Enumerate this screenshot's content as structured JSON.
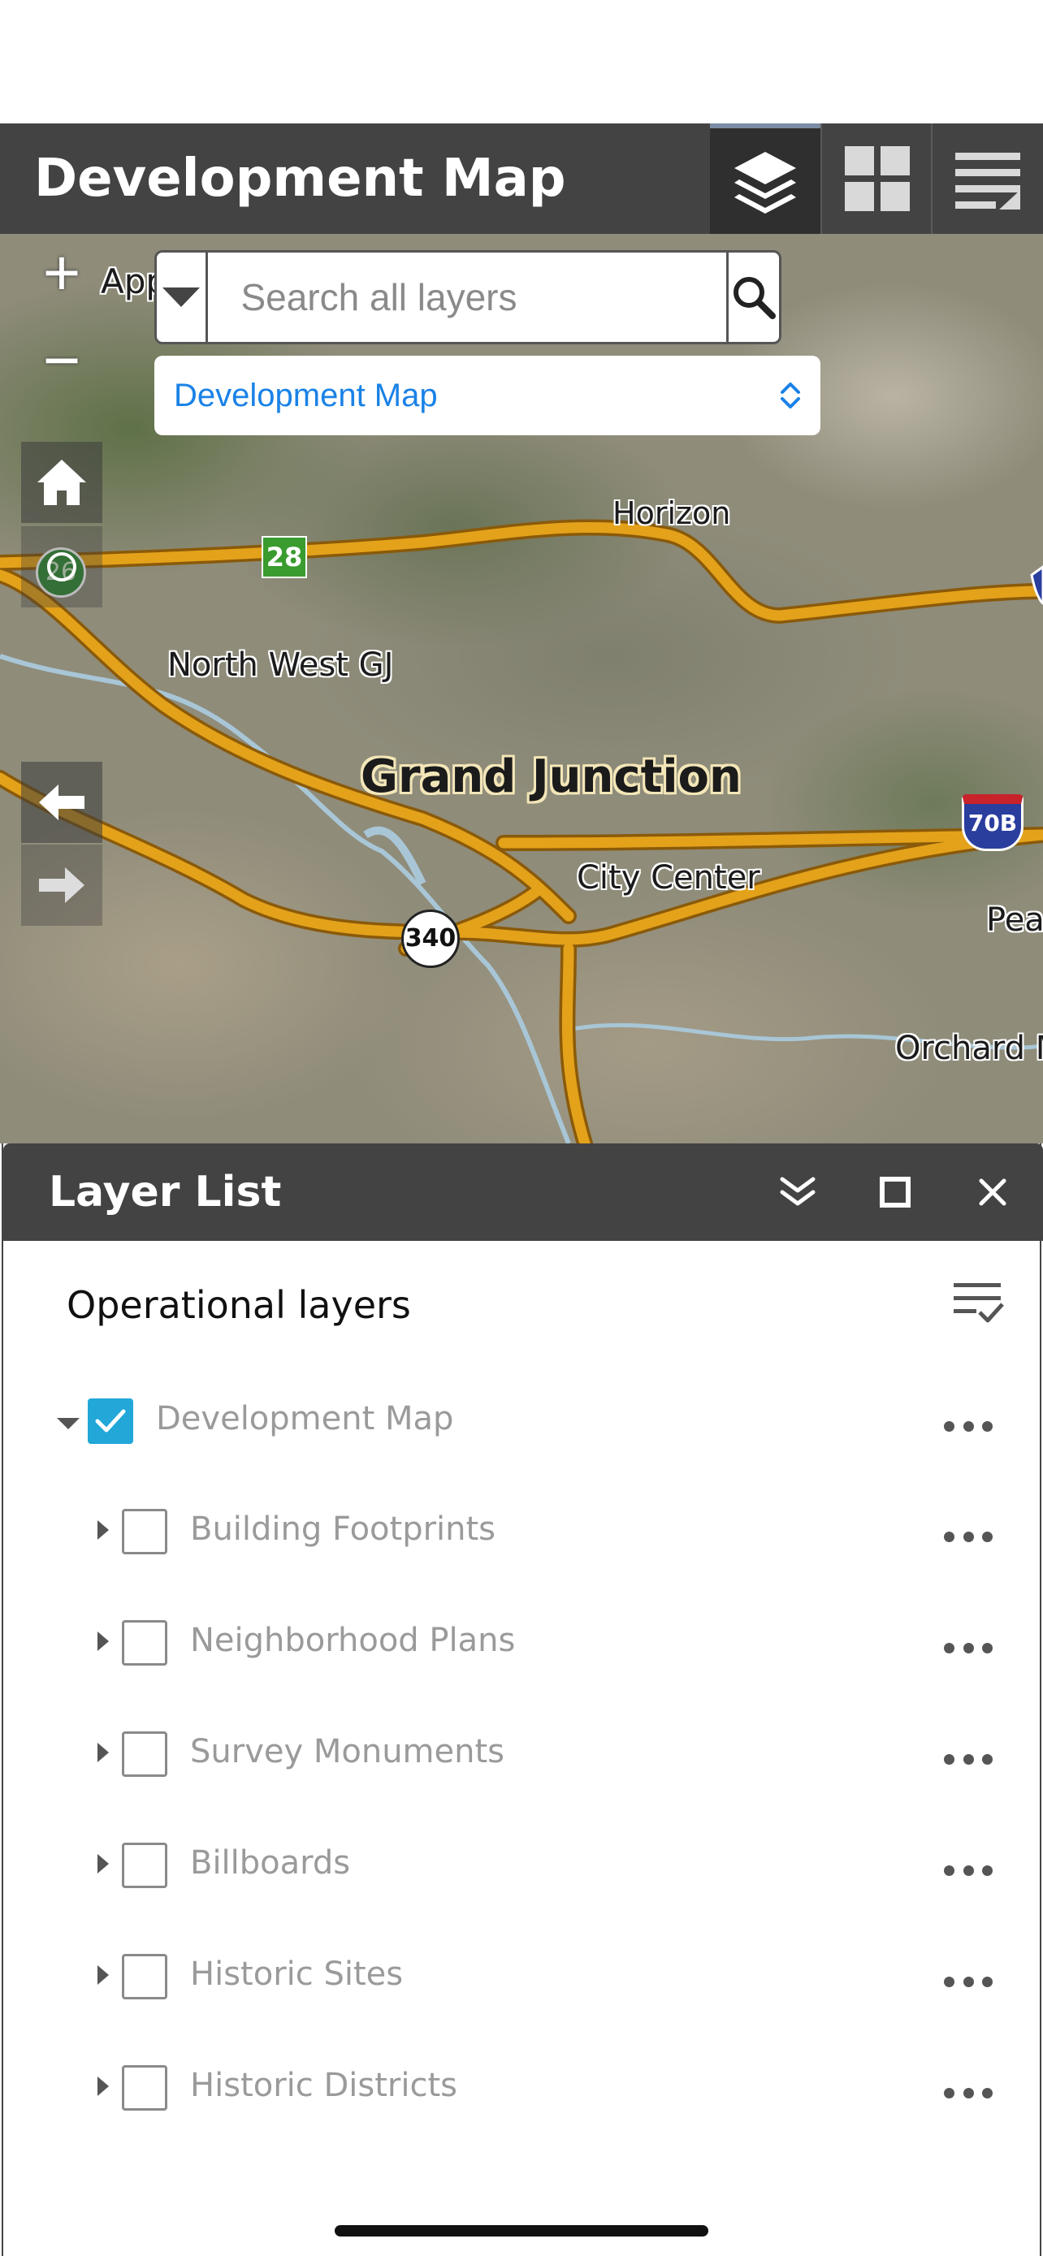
{
  "header": {
    "title": "Development Map",
    "tools": [
      {
        "name": "layers-icon",
        "active": true
      },
      {
        "name": "grid-icon",
        "active": false
      },
      {
        "name": "menu-icon",
        "active": false
      }
    ]
  },
  "map": {
    "search": {
      "placeholder": "Search all layers"
    },
    "map_selector": {
      "value": "Development Map"
    },
    "labels": {
      "app_partial": "App",
      "horizon": "Horizon",
      "north_west_gj": "North West GJ",
      "grand_junction": "Grand Junction",
      "city_center": "City Center",
      "pea_partial": "Pea",
      "orchard_partial": "Orchard M"
    },
    "shields": {
      "route_28": "28",
      "route_26": "26",
      "route_340": "340",
      "route_70b": "70B"
    },
    "controls": {
      "zoom_in": "+",
      "zoom_out": "−"
    }
  },
  "layer_list": {
    "title": "Layer List",
    "section_title": "Operational layers",
    "layers": [
      {
        "label": "Development Map",
        "checked": true,
        "expanded": true,
        "level": 0
      },
      {
        "label": "Building Footprints",
        "checked": false,
        "expanded": false,
        "level": 1
      },
      {
        "label": "Neighborhood Plans",
        "checked": false,
        "expanded": false,
        "level": 1
      },
      {
        "label": "Survey Monuments",
        "checked": false,
        "expanded": false,
        "level": 1
      },
      {
        "label": "Billboards",
        "checked": false,
        "expanded": false,
        "level": 1
      },
      {
        "label": "Historic Sites",
        "checked": false,
        "expanded": false,
        "level": 1
      },
      {
        "label": "Historic Districts",
        "checked": false,
        "expanded": false,
        "level": 1
      }
    ]
  },
  "colors": {
    "header_bg": "#434343",
    "accent_blue": "#1a82e6",
    "checkbox_checked": "#22a7d8",
    "road": "#e3a21a"
  }
}
